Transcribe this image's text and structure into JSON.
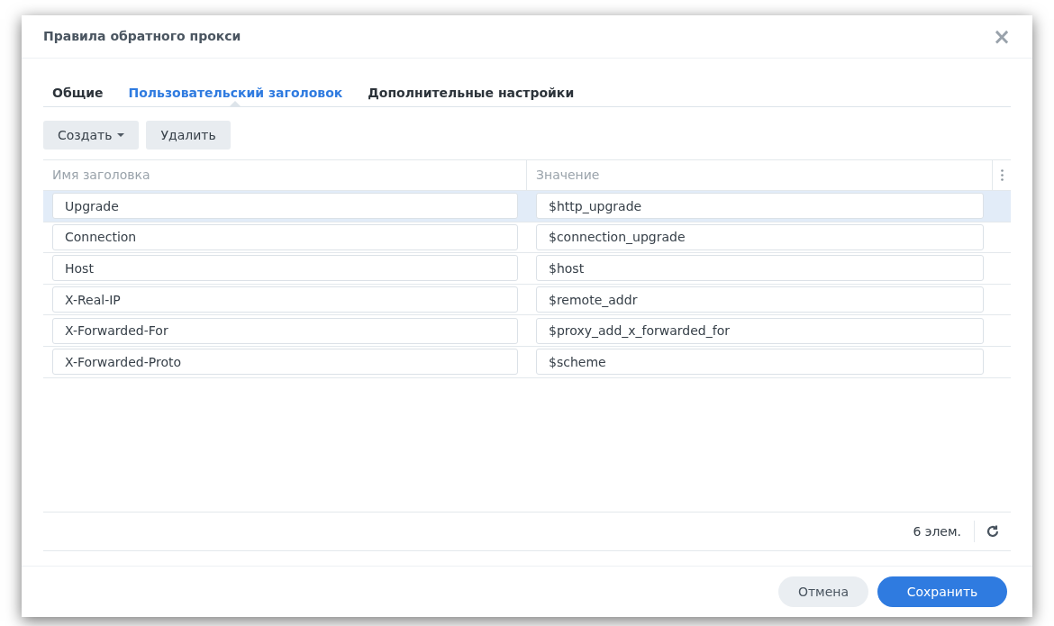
{
  "window": {
    "title": "Правила обратного прокси",
    "close": "×"
  },
  "tabs": [
    {
      "label": "Общие",
      "selected": false
    },
    {
      "label": "Пользовательский заголовок",
      "selected": true
    },
    {
      "label": "Дополнительные настройки",
      "selected": false
    }
  ],
  "toolbar": {
    "create": "Создать",
    "delete": "Удалить"
  },
  "table": {
    "columns": [
      "Имя заголовка",
      "Значение"
    ],
    "rows": [
      {
        "name": "Upgrade",
        "value": "$http_upgrade",
        "selected": true
      },
      {
        "name": "Connection",
        "value": "$connection_upgrade",
        "selected": false
      },
      {
        "name": "Host",
        "value": "$host",
        "selected": false
      },
      {
        "name": "X-Real-IP",
        "value": "$remote_addr",
        "selected": false
      },
      {
        "name": "X-Forwarded-For",
        "value": "$proxy_add_x_forwarded_for",
        "selected": false
      },
      {
        "name": "X-Forwarded-Proto",
        "value": "$scheme",
        "selected": false
      }
    ]
  },
  "status_bar": {
    "count": "6 элем."
  },
  "buttons": {
    "cancel": "Отмена",
    "save": "Сохранить"
  }
}
